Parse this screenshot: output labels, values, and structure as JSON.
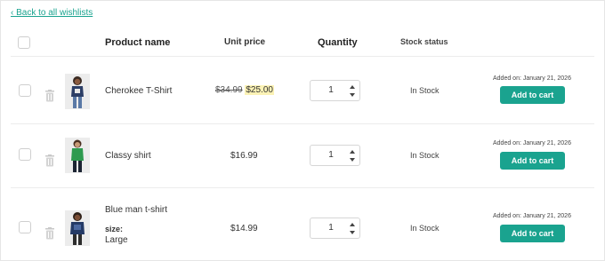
{
  "back_link": "‹ Back to all wishlists",
  "headers": {
    "product": "Product name",
    "price": "Unit price",
    "quantity": "Quantity",
    "stock": "Stock status"
  },
  "rows": [
    {
      "name": "Cherokee T-Shirt",
      "old_price": "$34.99",
      "price": "$25.00",
      "quantity": "1",
      "stock": "In Stock",
      "added_on": "Added on: January 21, 2026",
      "cart_label": "Add to cart"
    },
    {
      "name": "Classy shirt",
      "price": "$16.99",
      "quantity": "1",
      "stock": "In Stock",
      "added_on": "Added on: January 21, 2026",
      "cart_label": "Add to cart"
    },
    {
      "name": "Blue man t-shirt",
      "meta_label": "size:",
      "meta_value": "Large",
      "price": "$14.99",
      "quantity": "1",
      "stock": "In Stock",
      "added_on": "Added on: January 21, 2026",
      "cart_label": "Add to cart"
    }
  ],
  "colors": {
    "accent": "#1aa38f",
    "sale_highlight": "#fbf2b5"
  },
  "icons": {
    "delete": "trash-icon",
    "quantity": "up-down-arrows-icon"
  }
}
